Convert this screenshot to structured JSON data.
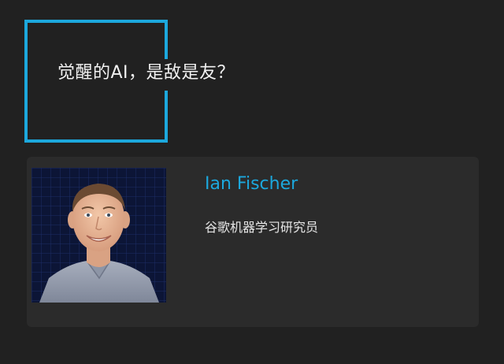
{
  "headline": "觉醒的AI，是敌是友？",
  "speaker": {
    "name": "Ian Fischer",
    "title": "谷歌机器学习研究员"
  },
  "colors": {
    "background": "#212121",
    "card": "#2b2b2b",
    "accent": "#1ca8dd",
    "text": "#f2f2f2"
  }
}
